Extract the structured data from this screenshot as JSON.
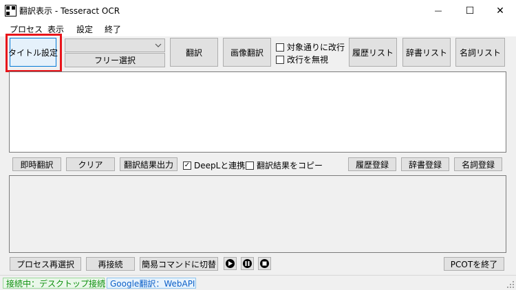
{
  "window": {
    "title": "翻訳表示 - Tesseract OCR",
    "minimize_glyph": "—",
    "maximize_glyph": "☐",
    "close_glyph": "✕"
  },
  "menu": [
    "プロセス",
    "表示",
    "設定",
    "終了"
  ],
  "toolbar": {
    "title_setting": "タイトル設定",
    "combo_value": "",
    "free_select": "フリー選択",
    "translate": "翻訳",
    "image_translate": "画像翻訳",
    "chk_line_break": "対象通りに改行",
    "chk_ignore_break": "改行を無視",
    "history_list": "履歴リスト",
    "dictionary_list": "辞書リスト",
    "noun_list": "名詞リスト"
  },
  "source_text": "",
  "actions": {
    "instant_translate": "即時翻訳",
    "clear": "クリア",
    "output_result": "翻訳結果出力",
    "deepl_link": "DeepLと連携",
    "deepl_checked": true,
    "copy_result": "翻訳結果をコピー",
    "copy_checked": false,
    "history_register": "履歴登録",
    "dictionary_register": "辞書登録",
    "noun_register": "名詞登録"
  },
  "result_text": "",
  "bottom": {
    "reselect_process": "プロセス再選択",
    "reconnect": "再接続",
    "switch_simple": "簡易コマンドに切替",
    "quit_pcot": "PCOTを終了"
  },
  "status": {
    "connection": "接続中：デスクトップ接続",
    "connection_color": "#0a8f0a",
    "engine": "Google翻訳：WebAPI",
    "engine_color": "#0a5fc8"
  },
  "colors": {
    "highlight": "#e8141a",
    "accent": "#0078d7"
  }
}
